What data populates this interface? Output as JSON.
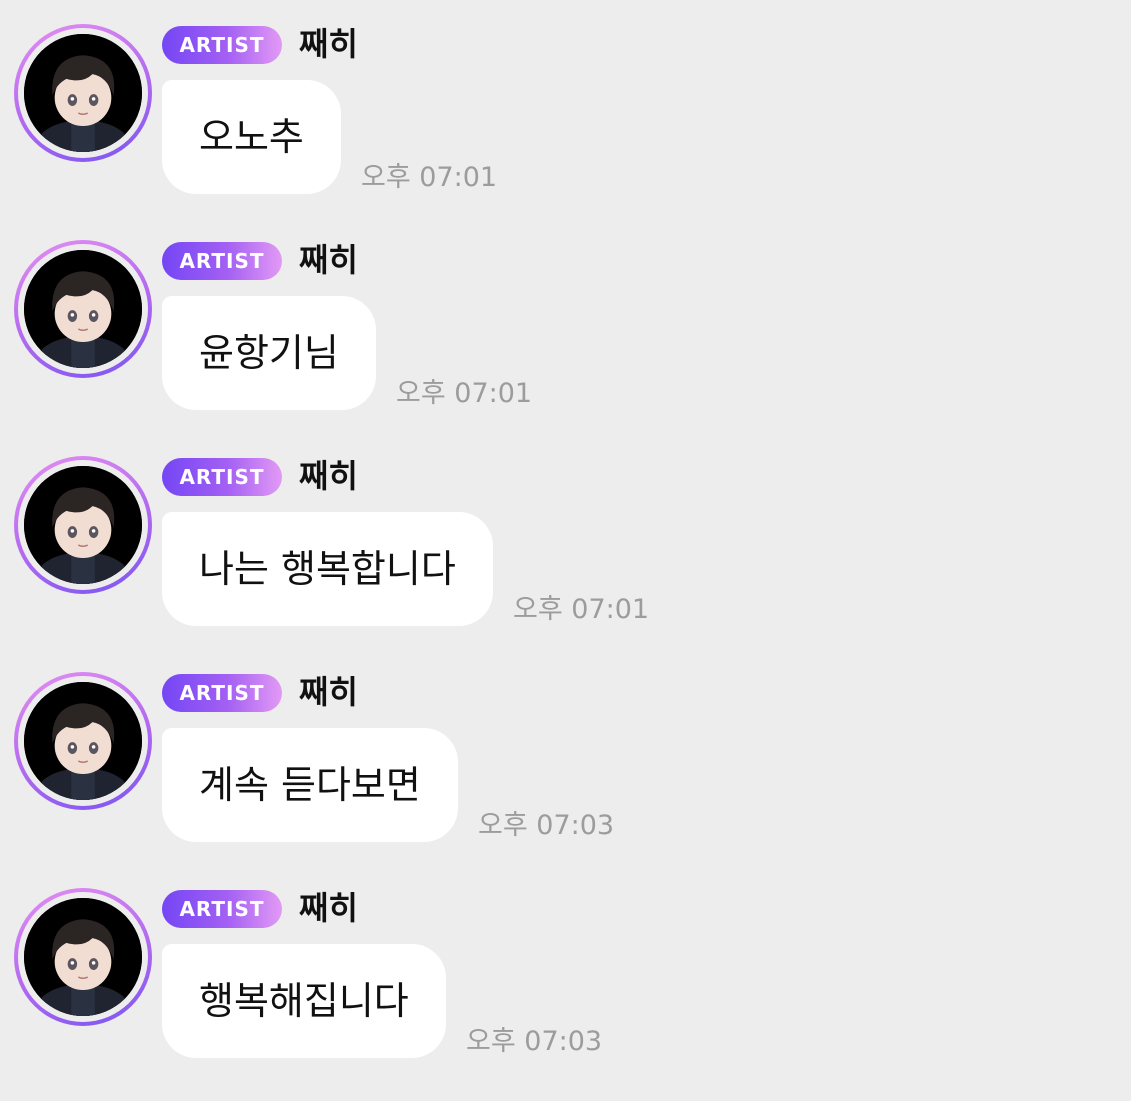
{
  "messages": [
    {
      "badge": "ARTIST",
      "name": "째히",
      "text": "오노추",
      "time": "오후 07:01"
    },
    {
      "badge": "ARTIST",
      "name": "째히",
      "text": "윤항기님",
      "time": "오후 07:01"
    },
    {
      "badge": "ARTIST",
      "name": "째히",
      "text": "나는 행복합니다",
      "time": "오후 07:01"
    },
    {
      "badge": "ARTIST",
      "name": "째히",
      "text": "계속 듣다보면",
      "time": "오후 07:03"
    },
    {
      "badge": "ARTIST",
      "name": "째히",
      "text": "행복해집니다",
      "time": "오후 07:03"
    }
  ],
  "colors": {
    "background": "#ededed",
    "bubble": "#ffffff",
    "badge_start": "#7446f4",
    "badge_end": "#e29af4",
    "time_text": "#9c9c9c"
  },
  "icons": {
    "avatar": "artist-avatar-illustration"
  }
}
